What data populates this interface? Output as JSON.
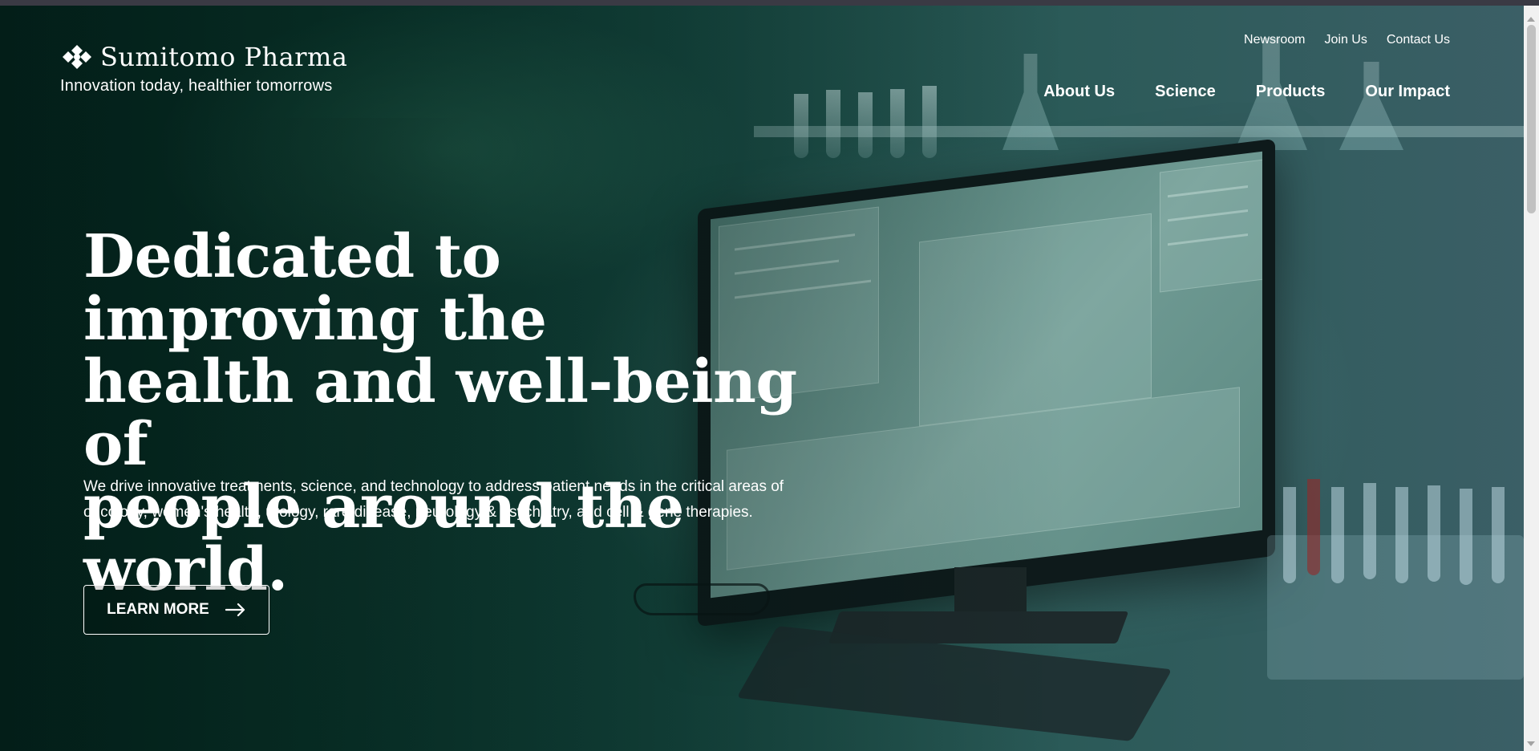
{
  "brand": {
    "name": "Sumitomo Pharma",
    "tagline": "Innovation today, healthier tomorrows",
    "logo_icon": "sumitomo-diamond-logo"
  },
  "utility_nav": {
    "items": [
      "Newsroom",
      "Join Us",
      "Contact Us"
    ]
  },
  "main_nav": {
    "items": [
      "About Us",
      "Science",
      "Products",
      "Our Impact"
    ]
  },
  "hero": {
    "headline_lines": [
      "Dedicated to improving the",
      "health and well-being of",
      "people around the world."
    ],
    "subcopy_lines": [
      "We drive innovative treatments, science, and technology to address patient needs in the critical areas of",
      "oncology, women's health, urology, rare disease, neurology & psychiatry, and cell & gene therapies."
    ],
    "cta_label": "LEARN MORE",
    "cta_icon": "arrow-right-icon",
    "background": "laboratory-with-monitor-photo"
  },
  "colors": {
    "accent_green": "#0b3b30",
    "text": "#ffffff"
  }
}
